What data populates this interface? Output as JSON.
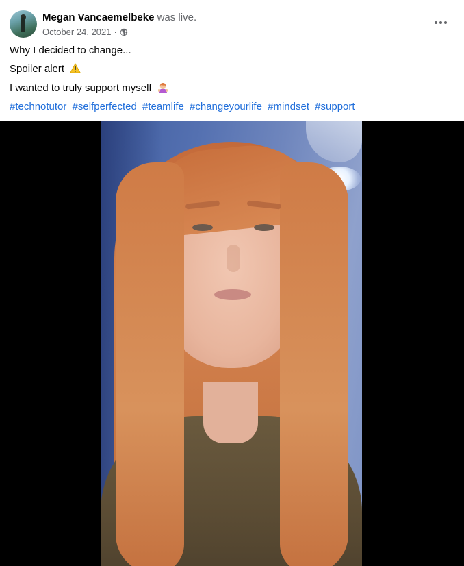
{
  "post": {
    "author": {
      "name": "Megan Vancaemelbeke",
      "action": "was live."
    },
    "meta": {
      "date": "October 24, 2021",
      "separator": "·",
      "privacy_icon": "globe-icon"
    },
    "more_icon": "more-options-icon",
    "text_lines": [
      "Why I decided to change...",
      "Spoiler alert",
      "I wanted to truly support myself"
    ],
    "emoji": {
      "warning": "warning-icon",
      "person": "person-gesturing-icon"
    },
    "hashtags": [
      "#technotutor",
      "#selfperfected",
      "#teamlife",
      "#changeyourlife",
      "#mindset",
      "#support"
    ]
  },
  "colors": {
    "link": "#216fdb",
    "secondary_text": "#65676b",
    "video_background": "#000000"
  }
}
